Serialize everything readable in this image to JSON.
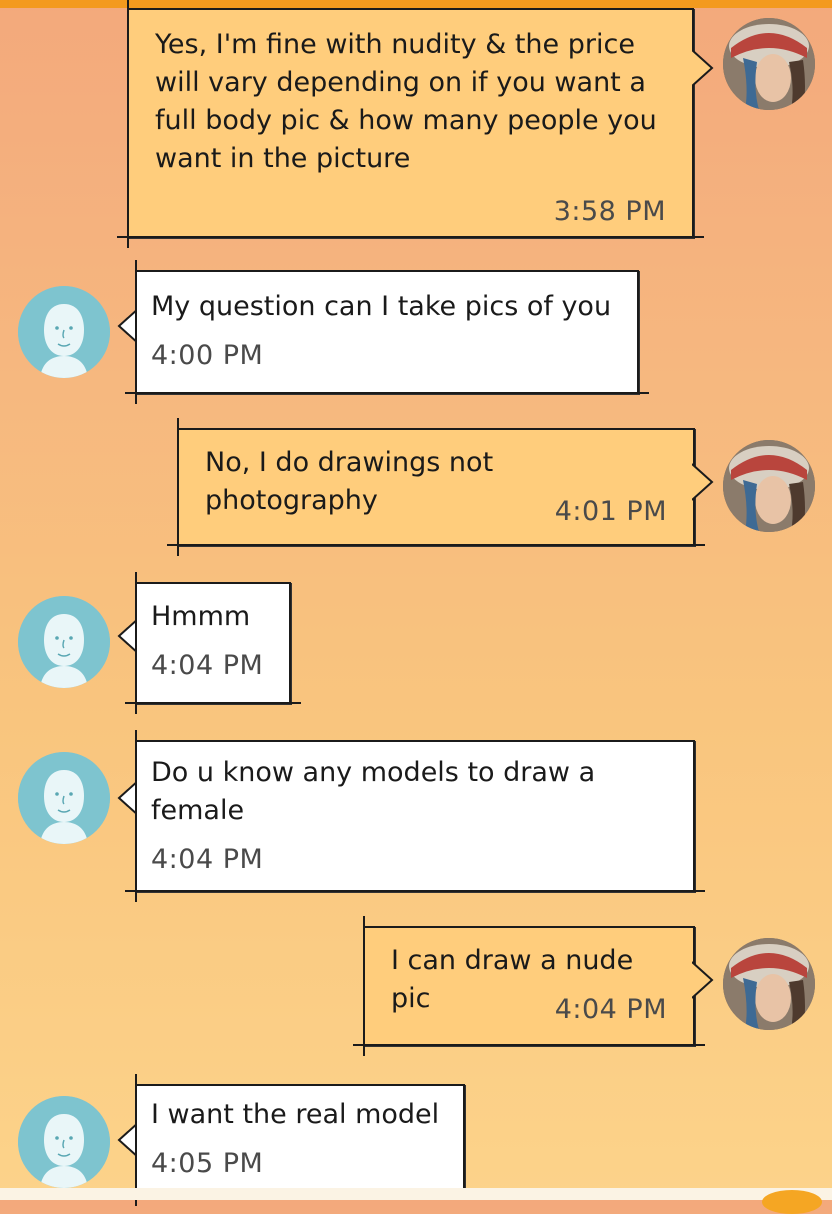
{
  "colors": {
    "accent": "#f39a1e",
    "outgoing_bubble": "#ffcd7c",
    "incoming_bubble": "#ffffff",
    "contact_avatar": "#7ec4cf"
  },
  "messages": [
    {
      "direction": "outgoing",
      "text": "Yes, I'm fine with nudity & the price\nwill vary depending on if you want a\nfull body pic & how many people you\nwant in the picture",
      "time": "3:58 PM"
    },
    {
      "direction": "incoming",
      "text": "My question can I take pics of you",
      "time": "4:00 PM"
    },
    {
      "direction": "outgoing",
      "text": "No, I do drawings not photography",
      "time": "4:01 PM"
    },
    {
      "direction": "incoming",
      "text": "Hmmm",
      "time": "4:04 PM"
    },
    {
      "direction": "incoming",
      "text": "Do u know any models to draw a\nfemale",
      "time": "4:04 PM"
    },
    {
      "direction": "outgoing",
      "text": "I can draw a nude pic",
      "time": "4:04 PM"
    },
    {
      "direction": "incoming",
      "text": "I want the real model",
      "time": "4:05 PM"
    }
  ],
  "icons": {
    "contact_avatar": "default-person-icon",
    "my_avatar": "artwork-profile-photo"
  }
}
